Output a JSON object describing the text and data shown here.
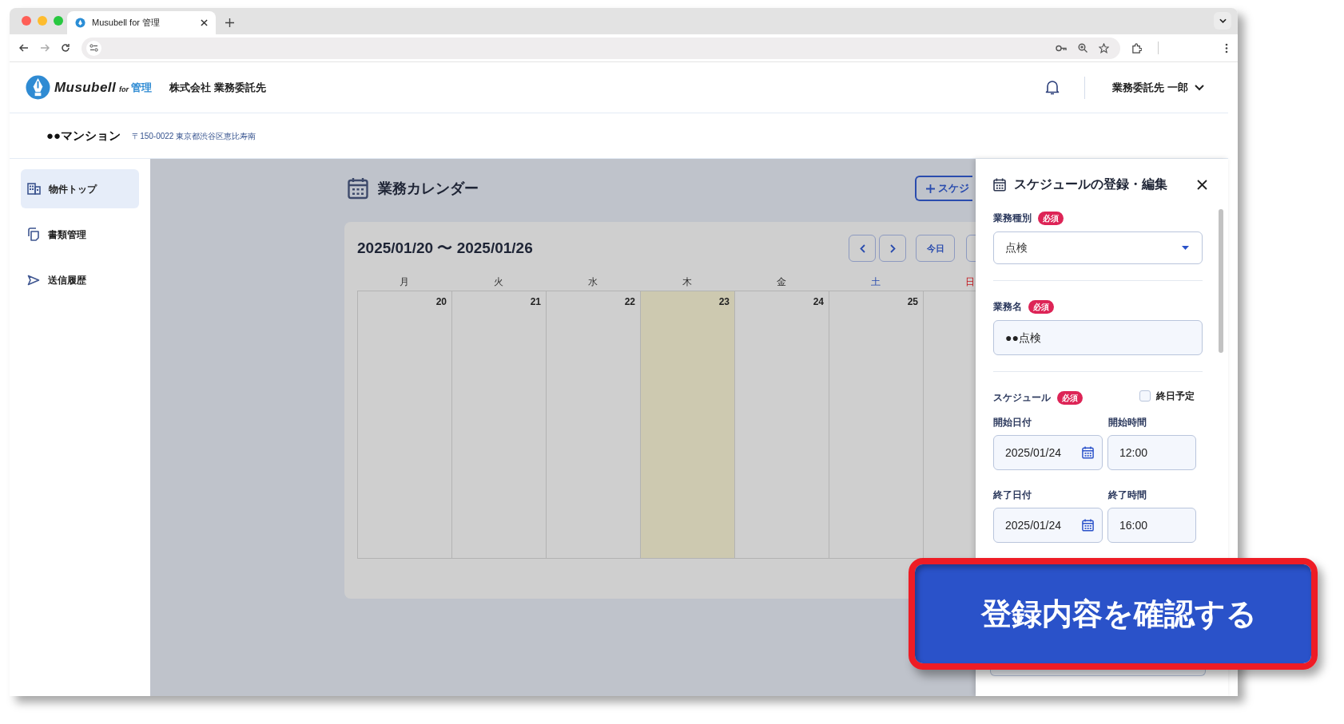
{
  "browser": {
    "tab_title": "Musubell for 管理"
  },
  "header": {
    "logo": {
      "name": "Musubell",
      "for": "for",
      "suffix": "管理"
    },
    "company": "株式会社 業務委託先",
    "user": "業務委託先 一郎"
  },
  "property": {
    "name": "●●マンション",
    "address": "〒150-0022 東京都渋谷区恵比寿南"
  },
  "sidebar": {
    "items": [
      {
        "label": "物件トップ",
        "kind": "building",
        "selected": true
      },
      {
        "label": "書類管理",
        "kind": "documents",
        "selected": false
      },
      {
        "label": "送信履歴",
        "kind": "send",
        "selected": false
      }
    ]
  },
  "calendar": {
    "title": "業務カレンダー",
    "add_button": "スケジ",
    "range": "2025/01/20 〜 2025/01/26",
    "today_button": "今日",
    "weekdays": [
      {
        "label": "月",
        "kind": "weekday"
      },
      {
        "label": "火",
        "kind": "weekday"
      },
      {
        "label": "水",
        "kind": "weekday"
      },
      {
        "label": "木",
        "kind": "weekday"
      },
      {
        "label": "金",
        "kind": "weekday"
      },
      {
        "label": "土",
        "kind": "saturday"
      },
      {
        "label": "日",
        "kind": "sunday"
      }
    ],
    "days": [
      {
        "number": "20",
        "today": false
      },
      {
        "number": "21",
        "today": false
      },
      {
        "number": "22",
        "today": false
      },
      {
        "number": "23",
        "today": true
      },
      {
        "number": "24",
        "today": false
      },
      {
        "number": "25",
        "today": false
      }
    ]
  },
  "panel": {
    "title": "スケジュールの登録・編集",
    "sections": [
      {
        "kind": "select",
        "label": "業務種別",
        "badge": "必須",
        "value": "点検"
      },
      {
        "kind": "text",
        "label": "業務名",
        "badge": "必須",
        "value": "●●点検"
      },
      {
        "kind": "schedule",
        "label": "スケジュール",
        "badge": "必須",
        "all_day": {
          "label": "終日予定",
          "checked": false
        },
        "rows": [
          {
            "date_label": "開始日付",
            "date": "2025/01/24",
            "time_label": "開始時間",
            "time": "12:00"
          },
          {
            "date_label": "終了日付",
            "date": "2025/01/24",
            "time_label": "終了時間",
            "time": "16:00"
          }
        ]
      }
    ]
  },
  "callout": {
    "button": "登録内容を確認する"
  }
}
